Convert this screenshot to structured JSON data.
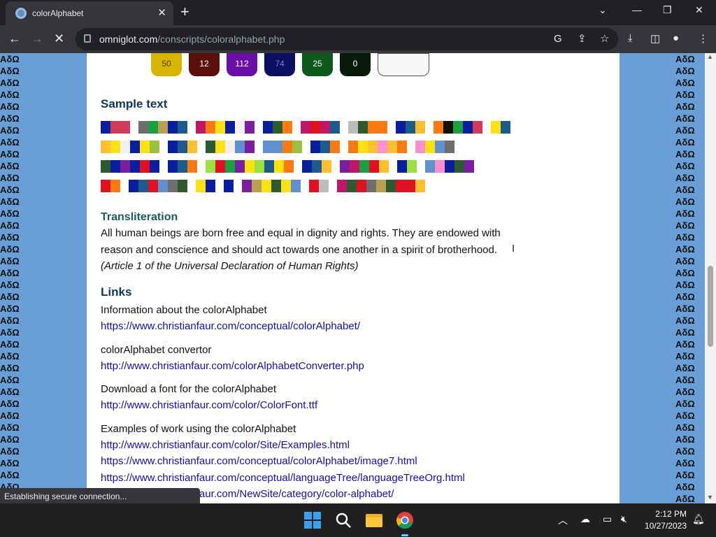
{
  "browser": {
    "tab_title": "colorAlphabet",
    "url_host": "omniglot.com",
    "url_path": "/conscripts/coloralphabet.php"
  },
  "palette_row": [
    {
      "top": "",
      "bottom": "50",
      "color": "#d6b400",
      "text_color": "#5a4500"
    },
    {
      "top": "",
      "bottom": "12",
      "color": "#5a1009",
      "text_color": "#ffffff"
    },
    {
      "top": "",
      "bottom": "112",
      "color": "#6a10a8",
      "text_color": "#ffffff"
    },
    {
      "top": "",
      "bottom": "74",
      "color": "#0a0f62",
      "text_color": "#7a80c0"
    },
    {
      "top": "",
      "bottom": "25",
      "color": "#0d5a1a",
      "text_color": "#ffffff"
    },
    {
      "top": "",
      "bottom": "0",
      "color": "#0a1a0a",
      "text_color": "#ffffff"
    },
    {
      "top": "",
      "bottom": "",
      "color": "#f7f7f7",
      "text_color": "#333333"
    }
  ],
  "sample_text_heading": "Sample text",
  "sample_rows": [
    [
      "#0a1fa0",
      "#d23a5a",
      "#d23a5a",
      "",
      "#6e6e6e",
      "#1aa040",
      "#b8a050",
      "#0a1fa0",
      "#1c5c8a",
      "",
      "#c0166a",
      "#ff7a10",
      "#ffe010",
      "#0a1fa0",
      "#f0f0f0",
      "#7a1fa0",
      "",
      "#0a1fa0",
      "#2e5a30",
      "#ff7a10",
      "",
      "#c0166a",
      "#e01020",
      "#c0166a",
      "#1c5c8a",
      "",
      "#bcbcbc",
      "#2e5a30",
      "#ff7a10",
      "#ff7a10",
      "",
      "#0a1fa0",
      "#1c5c8a",
      "#ffc030",
      "",
      "#ff7a10",
      "#101010",
      "#1aa040",
      "#0a1fa0",
      "#d23a5a",
      "",
      "#ffe010",
      "#1c5c8a"
    ],
    [
      "#ffc030",
      "#ffe010",
      "#f0f0f0",
      "#0a1fa0",
      "#ffe010",
      "#9ac040",
      "",
      "#0a1fa0",
      "#1c5c8a",
      "#ffc030",
      "",
      "#2e5a30",
      "#ffe010",
      "#f0f0f0",
      "#6090d0",
      "#7a1fa0",
      "",
      "#6090d0",
      "#6090d0",
      "#ff7a10",
      "#9ac040",
      "",
      "#0a1fa0",
      "#1c5c8a",
      "#ff7a10",
      "",
      "#ff7a10",
      "#ffe010",
      "#ffc030",
      "#ff90d0",
      "#ffc030",
      "#ff7a10",
      "",
      "#ff90d0",
      "#ffe010",
      "#6090d0",
      "#6e6e6e"
    ],
    [
      "#2e5a30",
      "#0a1fa0",
      "#7a1fa0",
      "#0a1fa0",
      "#e01020",
      "#0a1fa0",
      "",
      "#0a1fa0",
      "#1c5c8a",
      "#ff7a10",
      "",
      "#9ae040",
      "#e01020",
      "#1aa040",
      "#7a1fa0",
      "#ffe010",
      "#9ae040",
      "#1c5c8a",
      "#ffe010",
      "#ff7a10",
      "",
      "#0a1fa0",
      "#1c5c8a",
      "#ffc030",
      "",
      "#7a1fa0",
      "#c0166a",
      "#1aa040",
      "#e01020",
      "#ffc030",
      "",
      "#0a1fa0",
      "#9ae040",
      "",
      "#6090d0",
      "#ff90d0",
      "#0a1fa0",
      "#2e5a30",
      "#7a1fa0"
    ],
    [
      "#e01020",
      "#ff7a10",
      "",
      "#0a1fa0",
      "#1c5c8a",
      "#e01020",
      "#6090d0",
      "#6e6e6e",
      "#2e5a30",
      "",
      "#ffe010",
      "#0a1fa0",
      "",
      "#0a1fa0",
      "",
      "#7a1fa0",
      "#b8a050",
      "#ffe010",
      "#2e5a30",
      "#ffe010",
      "#6090d0",
      "",
      "#e01020",
      "#bcbcbc",
      "",
      "#c0166a",
      "#2e5a30",
      "#e01020",
      "#6e6e6e",
      "#b8a050",
      "#2e5a30",
      "#e01020",
      "#e01020",
      "#ffc030"
    ]
  ],
  "transliteration_heading": "Transliteration",
  "transliteration_line1": "All human beings are born free and equal in dignity and rights. They are endowed with",
  "transliteration_line2": "reason and conscience and should act towards one another in a spirit of brotherhood.",
  "transliteration_source": "(Article 1 of the Universal Declaration of Human Rights)",
  "links_heading": "Links",
  "link_groups": [
    {
      "label": "Information about the colorAlphabet",
      "urls": [
        "https://www.christianfaur.com/conceptual/colorAlphabet/"
      ]
    },
    {
      "label": "colorAlphabet convertor",
      "urls": [
        "http://www.christianfaur.com/colorAlphabetConverter.php"
      ]
    },
    {
      "label": "Download a font for the colorAlphabet",
      "urls": [
        "http://www.christianfaur.com/color/ColorFont.ttf"
      ]
    },
    {
      "label": "Examples of work using the colorAlphabet",
      "urls": [
        "http://www.christianfaur.com/color/Site/Examples.html",
        "https://www.christianfaur.com/conceptual/colorAlphabet/image7.html",
        "https://www.christianfaur.com/conceptual/languageTree/languageTreeOrg.html",
        "https://www.christianfaur.com/NewSite/category/color-alphabet/"
      ]
    }
  ],
  "status_text": "Establishing secure connection...",
  "taskbar": {
    "time": "2:12 PM",
    "date": "10/27/2023"
  },
  "side_strip_glyphs": "AδΩ",
  "colors": {
    "heading": "#0c3858",
    "translit_heading": "#1b5e57",
    "link": "#1a0dab",
    "side_bg": "#699fd6"
  }
}
